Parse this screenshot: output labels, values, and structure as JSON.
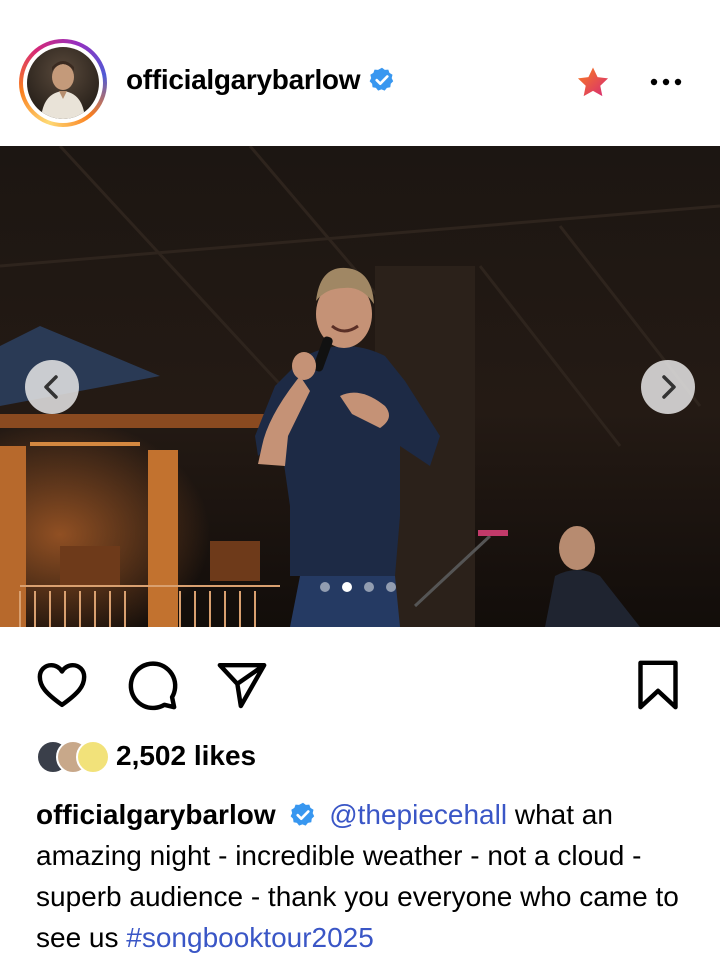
{
  "header": {
    "username": "officialgarybarlow",
    "verified": true,
    "favorite_icon": "star-icon",
    "more_icon": "more-horizontal-icon"
  },
  "post": {
    "carousel": {
      "total_slides": 4,
      "active_slide": 2,
      "prev_icon": "chevron-left-icon",
      "next_icon": "chevron-right-icon"
    },
    "actions": {
      "like_icon": "heart-icon",
      "comment_icon": "comment-icon",
      "share_icon": "send-icon",
      "save_icon": "bookmark-icon"
    },
    "likes_text": "2,502 likes",
    "caption": {
      "username": "officialgarybarlow",
      "mention": "@thepiecehall",
      "text": " what an amazing night - incredible weather - not a cloud - superb audience - thank you everyone who came to see us ",
      "hashtag": "#songbooktour2025"
    }
  },
  "colors": {
    "verified_blue": "#3897f0",
    "link_blue": "#3a56c6",
    "star_gradient_start": "#fa7e1e",
    "star_gradient_end": "#d62976"
  }
}
